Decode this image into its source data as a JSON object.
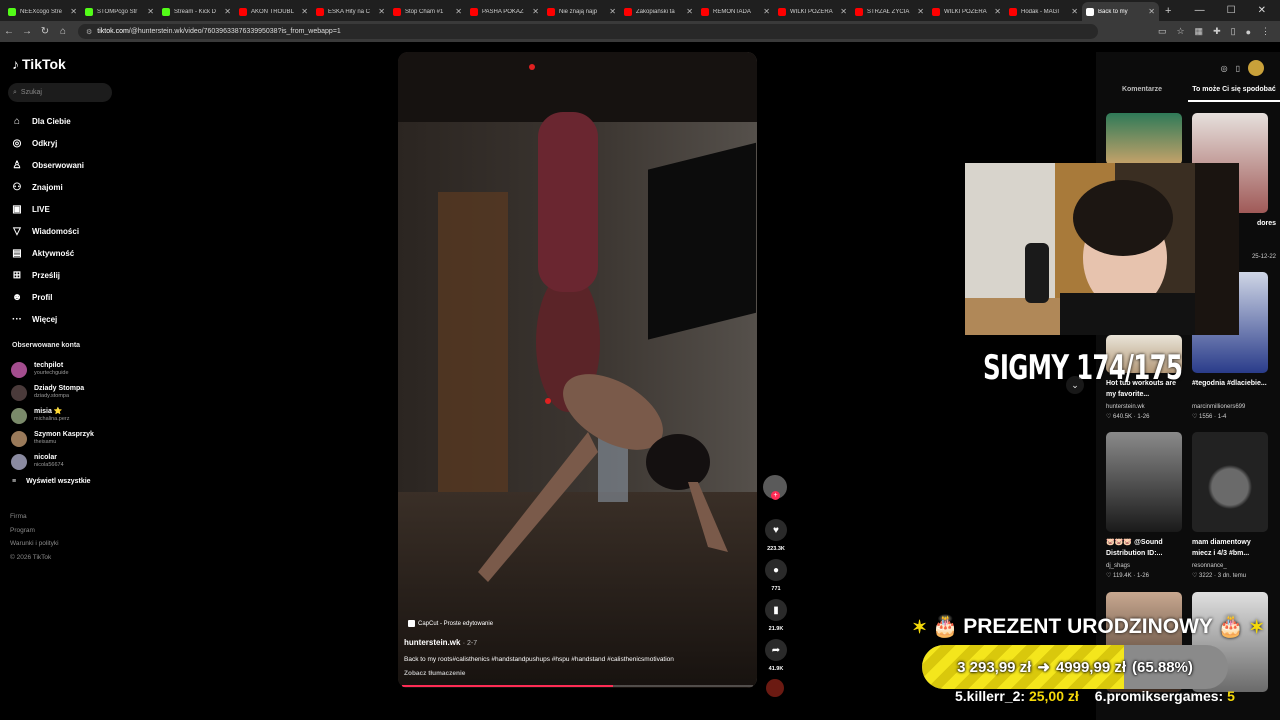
{
  "browser": {
    "tabs": [
      {
        "title": "NEEXcogo Stre",
        "color": "#53fc18"
      },
      {
        "title": "STOMPcgo Str",
        "color": "#53fc18"
      },
      {
        "title": "Stream - Kick D",
        "color": "#53fc18"
      },
      {
        "title": "AKON TROUBL",
        "color": "#ff0000"
      },
      {
        "title": "ESKA Hity na C",
        "color": "#ff0000"
      },
      {
        "title": "Stop Cham #1",
        "color": "#ff0000"
      },
      {
        "title": "PASHA POKAZ",
        "color": "#ff0000"
      },
      {
        "title": "Nie znają najp",
        "color": "#ff0000"
      },
      {
        "title": "Zakopiański ta",
        "color": "#ff0000"
      },
      {
        "title": "REMONTADA",
        "color": "#ff0000"
      },
      {
        "title": "WILKI POŻERA",
        "color": "#ff0000"
      },
      {
        "title": "STRZAŁ ŻYCIA",
        "color": "#ff0000"
      },
      {
        "title": "WILKI POŻERA",
        "color": "#ff0000"
      },
      {
        "title": "Hodak - MAGI",
        "color": "#ff0000"
      },
      {
        "title": "Back to my",
        "color": "#ffffff"
      }
    ],
    "url_host": "tiktok.com",
    "url_path": "/@hunterstein.wk/video/7603963387633995038?is_from_webapp=1"
  },
  "sidebar": {
    "logo": "TikTok",
    "search_placeholder": "Szukaj",
    "nav": [
      {
        "label": "Dla Ciebie",
        "icon": "home-icon",
        "glyph": "⌂"
      },
      {
        "label": "Odkryj",
        "icon": "compass-icon",
        "glyph": "◎"
      },
      {
        "label": "Obserwowani",
        "icon": "following-icon",
        "glyph": "♙"
      },
      {
        "label": "Znajomi",
        "icon": "friends-icon",
        "glyph": "⚇"
      },
      {
        "label": "LIVE",
        "icon": "live-icon",
        "glyph": "▣"
      },
      {
        "label": "Wiadomości",
        "icon": "messages-icon",
        "glyph": "▽"
      },
      {
        "label": "Aktywność",
        "icon": "activity-icon",
        "glyph": "▤"
      },
      {
        "label": "Prześlij",
        "icon": "upload-icon",
        "glyph": "⊞"
      },
      {
        "label": "Profil",
        "icon": "profile-icon",
        "glyph": "☻"
      },
      {
        "label": "Więcej",
        "icon": "more-icon",
        "glyph": "···"
      }
    ],
    "following_header": "Obserwowane konta",
    "following": [
      {
        "name": "techpilot",
        "handle": "yourtechguide",
        "color": "#a34d8e"
      },
      {
        "name": "Dziady Stompa",
        "handle": "dziady.stompa",
        "color": "#4a3a3a"
      },
      {
        "name": "misia ⭐",
        "handle": "michalina.perz",
        "color": "#7a8a6a"
      },
      {
        "name": "Szymon Kasprzyk",
        "handle": "theisamu",
        "color": "#9a7a5a"
      },
      {
        "name": "nicolar",
        "handle": "nicola56674",
        "color": "#8a8aa0"
      }
    ],
    "show_all": "Wyświetl wszystkie",
    "footer": [
      "Firma",
      "Program",
      "Warunki i polityki",
      "© 2026 TikTok"
    ]
  },
  "video": {
    "capcut": "CapCut - Proste edytowanie",
    "username": "hunterstein.wk",
    "date": "· 2-7",
    "description": "Back to my roots#calisthenics #handstandpushups #hspu #handstand #calisthenicsmotivation",
    "translate": "Zobacz tłumaczenie",
    "progress": 0.6
  },
  "actions": {
    "likes": "223.3K",
    "comments": "771",
    "saves": "21.9K",
    "shares": "41.9K"
  },
  "right_panel": {
    "tabs": [
      "Komentarze",
      "To może Ci się spodobać"
    ],
    "active_tab": 1,
    "partial_texts": [
      "dores",
      "25-12-22"
    ],
    "items": [
      {
        "caption": "Hot tub workouts are my favorite...",
        "author": "hunterstein.wk",
        "stats": "♡ 640.5K · 1-26"
      },
      {
        "caption": "#tegodnia #dlaciebie...",
        "author": "marcinmillioners699",
        "stats": "♡ 1556 · 1-4"
      },
      {
        "caption": "🐷🐷🐷 @Sound Distribution ID:...",
        "author": "dj_shags",
        "stats": "♡ 119.4K · 1-26"
      },
      {
        "caption": "mam diamentowy miecz i 4/3 #bm...",
        "author": "resonnance_",
        "stats": "♡ 3222 · 3 dn. temu"
      }
    ]
  },
  "overlay": {
    "sigmy": "SIGMY 174/175",
    "gift_title": "PREZENT URODZINOWY",
    "gift_current": "3 293,99 zł",
    "gift_target": "4999,99 zł",
    "gift_percent": "(65.88%)",
    "gift_fraction": 0.6588,
    "ticker": [
      {
        "name": "5.killerr_2:",
        "amount": "25,00 zł"
      },
      {
        "name": "6.promiksergames:",
        "amount": "5"
      }
    ]
  }
}
